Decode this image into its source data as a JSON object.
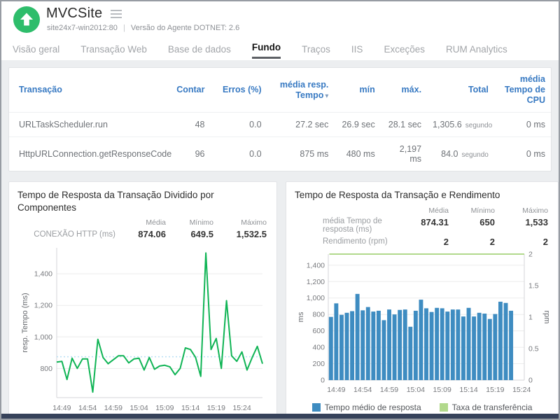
{
  "header": {
    "title": "MVCSite",
    "host": "site24x7-win2012:80",
    "sep": "|",
    "agent": "Versão do Agente DOTNET: 2.6"
  },
  "tabs": [
    {
      "label": "Visão geral",
      "active": false
    },
    {
      "label": "Transação Web",
      "active": false
    },
    {
      "label": "Base de dados",
      "active": false
    },
    {
      "label": "Fundo",
      "active": true
    },
    {
      "label": "Traços",
      "active": false
    },
    {
      "label": "IIS",
      "active": false
    },
    {
      "label": "Exceções",
      "active": false
    },
    {
      "label": "RUM Analytics",
      "active": false
    }
  ],
  "table": {
    "col_transacao": "Transação",
    "col_contar": "Contar",
    "col_erros": "Erros (%)",
    "col_media": "média resp. Tempo",
    "col_min": "mín",
    "col_max": "máx.",
    "col_total": "Total",
    "col_cpu": "média Tempo de CPU",
    "sort_icon": "▾",
    "rows": [
      {
        "name": "URLTaskScheduler.run",
        "count": "48",
        "errors": "0.0",
        "avg": "27.2 sec",
        "min": "26.9 sec",
        "max": "28.1 sec",
        "total": "1,305.6",
        "total_unit": "segundo",
        "cpu": "0 ms"
      },
      {
        "name": "HttpURLConnection.getResponseCode",
        "count": "96",
        "errors": "0.0",
        "avg": "875 ms",
        "min": "480 ms",
        "max": "2,197 ms",
        "total": "84.0",
        "total_unit": "segundo",
        "cpu": "0 ms"
      }
    ]
  },
  "stats_header": {
    "media": "Média",
    "minimo": "Mínimo",
    "maximo": "Máximo"
  },
  "chart_data": [
    {
      "type": "line",
      "title": "Tempo de Resposta da Transação Dividido por Componentes",
      "stats": {
        "label": "CONEXÃO HTTP (ms)",
        "media": "874.06",
        "minimo": "649.5",
        "maximo": "1,532.5"
      },
      "ylabel": "resp. Tempo (ms)",
      "ylim": [
        615,
        1565
      ],
      "yticks": [
        800,
        1000,
        1200,
        1400
      ],
      "avg_line": 874.06,
      "line_color": "#10b455",
      "avg_line_color": "#b9e0f4",
      "x_tick_labels": [
        "14:49",
        "14:54",
        "14:59",
        "15:04",
        "15:09",
        "15:14",
        "15:19",
        "15:24"
      ],
      "x_tick_indices": [
        1,
        6,
        11,
        16,
        21,
        26,
        31,
        36
      ],
      "values": [
        840,
        845,
        730,
        865,
        800,
        860,
        860,
        650,
        985,
        870,
        830,
        855,
        880,
        880,
        835,
        860,
        865,
        790,
        870,
        795,
        815,
        820,
        810,
        760,
        800,
        930,
        920,
        870,
        750,
        1532,
        920,
        990,
        800,
        1230,
        880,
        845,
        905,
        790,
        870,
        940,
        830
      ]
    },
    {
      "type": "bar+line",
      "title": "Tempo de Resposta da Transação e Rendimento",
      "stats": [
        {
          "label": "média Tempo de resposta (ms)",
          "media": "874.31",
          "minimo": "650",
          "maximo": "1,533"
        },
        {
          "label": "Rendimento (rpm)",
          "media": "2",
          "minimo": "2",
          "maximo": "2"
        }
      ],
      "ylabel_left": "ms",
      "ylabel_right": "rpm",
      "ylim_left": [
        0,
        1535
      ],
      "yticks_left": [
        0,
        200,
        400,
        600,
        800,
        1000,
        1200,
        1400
      ],
      "ylim_right": [
        0,
        2
      ],
      "yticks_right": [
        0,
        0.5,
        1,
        1.5,
        2
      ],
      "bar_color": "#3e8cc1",
      "line_color": "#b2d98c",
      "throughput_value": 2,
      "slots": 37,
      "x_tick_labels": [
        "14:49",
        "14:54",
        "14:59",
        "15:04",
        "15:09",
        "15:14",
        "15:19",
        "15:24"
      ],
      "x_tick_indices": [
        1,
        6,
        11,
        16,
        21,
        26,
        31,
        36
      ],
      "bar_values": [
        770,
        935,
        795,
        820,
        840,
        1050,
        850,
        890,
        835,
        845,
        730,
        860,
        800,
        855,
        860,
        650,
        845,
        980,
        875,
        830,
        880,
        875,
        835,
        860,
        860,
        775,
        880,
        775,
        820,
        810,
        745,
        805,
        955,
        940,
        845
      ],
      "legend": [
        {
          "label": "Tempo médio de resposta",
          "color": "#3e8cc1"
        },
        {
          "label": "Taxa de transferência",
          "color": "#b2d98c"
        }
      ]
    }
  ],
  "colors": {
    "logo_green": "#2ebd6b",
    "header_blue": "#3779c2",
    "bottom_bar": "#36425a"
  }
}
